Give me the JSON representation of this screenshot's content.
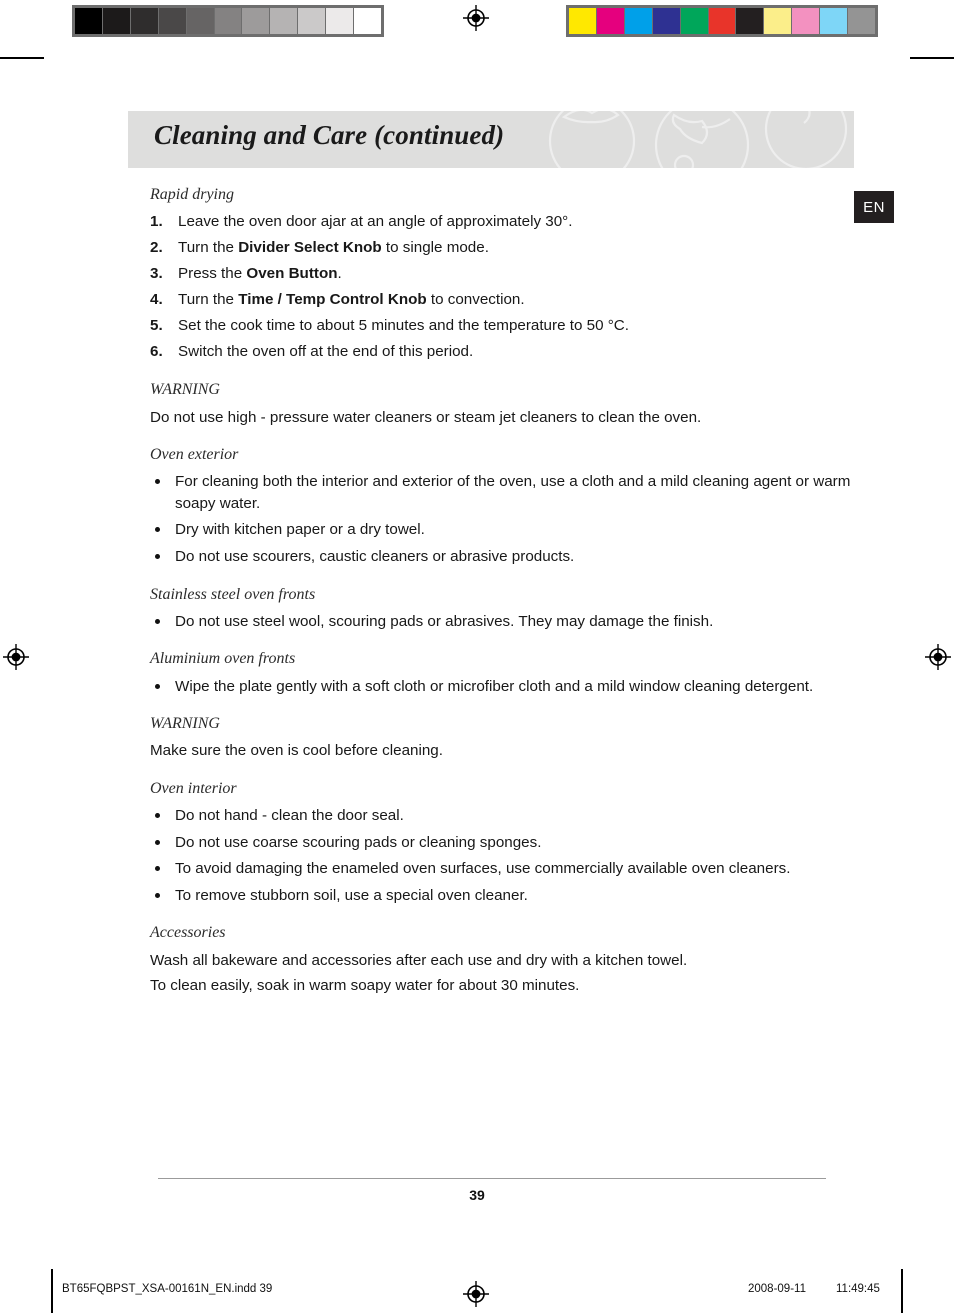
{
  "proof": {
    "gray_bar_name": "grayscale-step-wedge",
    "gray_patches": [
      "#000000",
      "#1c1a1a",
      "#2f2d2d",
      "#4a4848",
      "#666464",
      "#848282",
      "#9d9b9b",
      "#b5b3b3",
      "#cbc9c9",
      "#eceaea",
      "#ffffff"
    ],
    "color_bar_name": "cmyk-color-control-bar",
    "color_patches": [
      "#ffe800",
      "#e5007e",
      "#00a0e9",
      "#2e3192",
      "#00a65a",
      "#e8342a",
      "#231f20",
      "#fbee8a",
      "#f391c0",
      "#7ed6f7",
      "#949494"
    ]
  },
  "header": {
    "title": "Cleaning and Care (continued)",
    "band_color": "#dededd"
  },
  "language_tab": {
    "label": "EN",
    "background": "#231f20"
  },
  "content": {
    "rapid_drying": {
      "heading": "Rapid drying",
      "steps": [
        {
          "num": "1.",
          "text": "Leave the oven door ajar at an angle of approximately 30°."
        },
        {
          "num": "2.",
          "text": "Turn the <b>Divider Select Knob</b> to single mode."
        },
        {
          "num": "3.",
          "text": "Press the <b>Oven Button</b>."
        },
        {
          "num": "4.",
          "text": "Turn the <b>Time / Temp Control Knob</b> to convection."
        },
        {
          "num": "5.",
          "text": "Set the cook time to about 5 minutes and the temperature to 50 °C."
        },
        {
          "num": "6.",
          "text": "Switch the oven off at the end of this period."
        }
      ]
    },
    "warning_1": {
      "heading": "WARNING",
      "text": "Do not use high - pressure water cleaners or steam jet cleaners to clean the oven."
    },
    "oven_exterior": {
      "heading": "Oven exterior",
      "bullets": [
        "For cleaning both the interior and exterior of the oven, use a cloth and a mild cleaning agent or warm soapy water.",
        "Dry with kitchen paper or a dry towel.",
        "Do not use scourers, caustic cleaners or abrasive products."
      ]
    },
    "stainless_steel": {
      "heading": "Stainless steel oven fronts",
      "bullets": [
        "Do not use steel wool, scouring pads or abrasives. They may damage the finish."
      ]
    },
    "aluminium": {
      "heading": "Aluminium oven fronts",
      "bullets": [
        "Wipe the plate gently with a soft cloth or microfiber cloth and a mild window cleaning detergent."
      ]
    },
    "warning_2": {
      "heading": "WARNING",
      "text": "Make sure the oven is cool before cleaning."
    },
    "oven_interior": {
      "heading": "Oven interior",
      "bullets": [
        "Do not hand - clean the door seal.",
        "Do not use coarse scouring pads or cleaning sponges.",
        "To avoid damaging the enameled oven surfaces, use commercially available oven cleaners.",
        "To remove stubborn soil, use a special oven cleaner."
      ]
    },
    "accessories": {
      "heading": "Accessories",
      "line_1": "Wash all bakeware and accessories after each use and dry with a kitchen towel.",
      "line_2": "To clean easily, soak in warm soapy water for about 30 minutes."
    }
  },
  "page_number": "39",
  "footer": {
    "file_name": "BT65FQBPST_XSA-00161N_EN.indd   39",
    "date": "2008-09-11",
    "time": "11:49:45"
  }
}
